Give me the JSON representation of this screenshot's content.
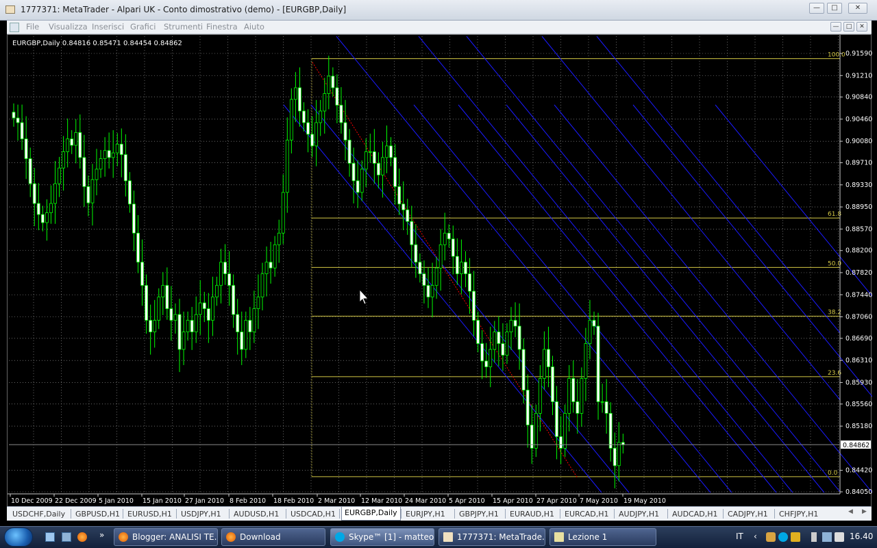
{
  "window": {
    "title": "1777371: MetaTrader - Alpari UK - Conto dimostrativo (demo) - [EURGBP,Daily]",
    "btn_min": "—",
    "btn_max": "□",
    "btn_close": "✕"
  },
  "menu": [
    "File",
    "Visualizza",
    "Inserisci",
    "Grafici",
    "Strumenti",
    "Finestra",
    "Aiuto"
  ],
  "chart": {
    "info": "EURGBP,Daily  0.84816 0.85471 0.84454 0.84862",
    "current_price": "0.84862",
    "price_labels": [
      "0.91590",
      "0.91210",
      "0.90840",
      "0.90460",
      "0.90080",
      "0.89710",
      "0.89330",
      "0.88950",
      "0.88570",
      "0.88200",
      "0.87820",
      "0.87440",
      "0.87060",
      "0.86690",
      "0.86310",
      "0.85930",
      "0.85560",
      "0.85180",
      "0.84420",
      "0.84050"
    ],
    "date_labels": [
      "10 Dec 2009",
      "22 Dec 2009",
      "5 Jan 2010",
      "15 Jan 2010",
      "27 Jan 2010",
      "8 Feb 2010",
      "18 Feb 2010",
      "2 Mar 2010",
      "12 Mar 2010",
      "24 Mar 2010",
      "5 Apr 2010",
      "15 Apr 2010",
      "27 Apr 2010",
      "7 May 2010",
      "19 May 2010"
    ],
    "fib_levels": [
      {
        "label": "100.0",
        "price": 0.915
      },
      {
        "label": "61.8",
        "price": 0.8876
      },
      {
        "label": "50.0",
        "price": 0.8791
      },
      {
        "label": "38.2",
        "price": 0.8707
      },
      {
        "label": "23.6",
        "price": 0.8603
      },
      {
        "label": "0.0",
        "price": 0.8431
      }
    ],
    "colors": {
      "bull": "#00ff00",
      "bear": "#ffffff",
      "fib": "#d4c845",
      "channel": "#1a1aff",
      "grid": "#a9a9a9",
      "trend": "#ff0000"
    }
  },
  "tabs": [
    "USDCHF,Daily",
    "GBPUSD,H1",
    "EURUSD,H1",
    "USDJPY,H1",
    "AUDUSD,H1",
    "USDCAD,H1",
    "EURGBP,Daily",
    "EURJPY,H1",
    "GBPJPY,H1",
    "EURAUD,H1",
    "EURCAD,H1",
    "AUDJPY,H1",
    "AUDCAD,H1",
    "CADJPY,H1",
    "CHFJPY,H1"
  ],
  "active_tab": "EURGBP,Daily",
  "taskbar": {
    "buttons": [
      "Blogger: ANALISI TE...",
      "Download",
      "Skype™ [1] - matteo...",
      "1777371: MetaTrade...",
      "Lezione 1"
    ],
    "lang": "IT",
    "clock": "16.40"
  }
}
